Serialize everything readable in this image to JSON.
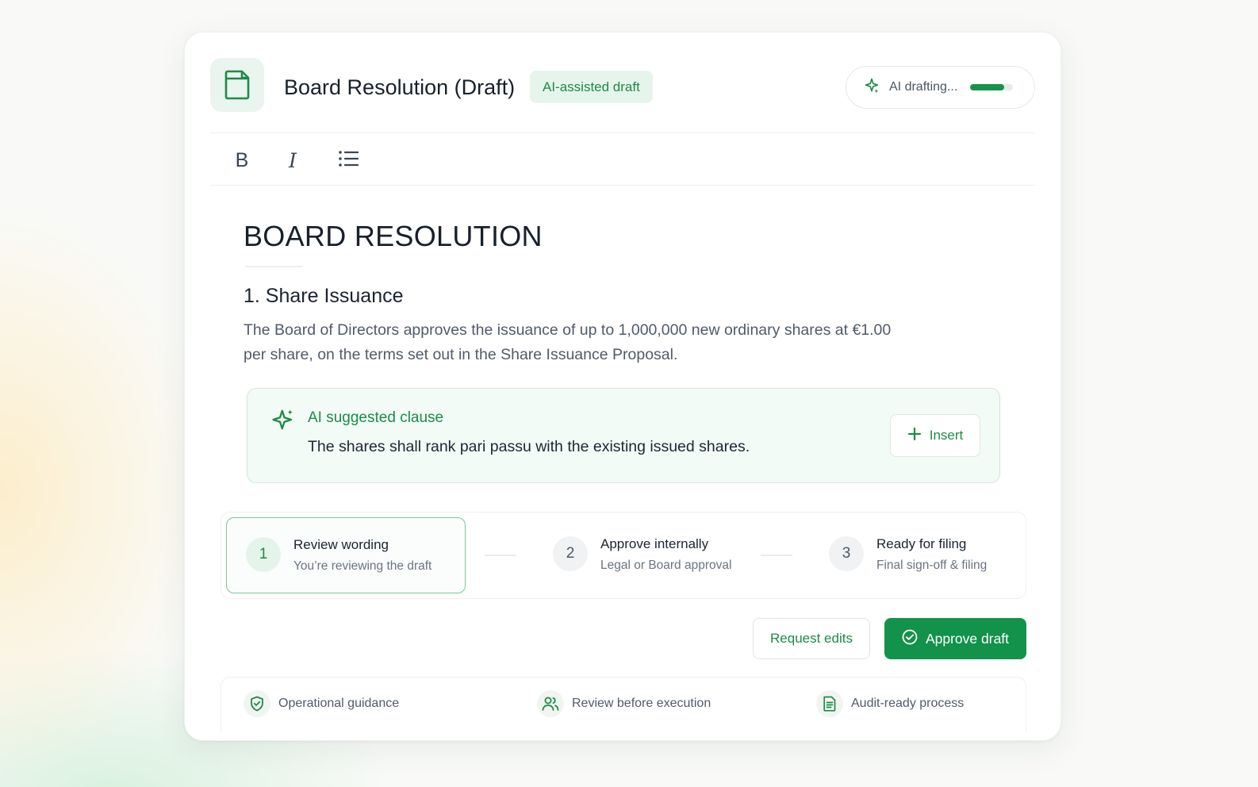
{
  "header": {
    "title": "Board Resolution (Draft)",
    "badge": "AI-assisted draft",
    "ai_status": "AI drafting...",
    "ai_progress_percent": 80,
    "doc_icon": "document-icon",
    "spark_icon": "sparkle-icon"
  },
  "toolbar": {
    "bold_label": "B",
    "italic_label": "I",
    "list_icon": "bulleted-list-icon"
  },
  "document": {
    "heading": "BOARD RESOLUTION",
    "section_title": "1. Share Issuance",
    "body": "The Board of Directors approves the issuance of up to 1,000,000 new ordinary shares at €1.00 per share, on the terms set out in the Share Issuance Proposal."
  },
  "ai_suggestion": {
    "title": "AI suggested clause",
    "text": "The shares shall rank pari passu with the existing issued shares.",
    "insert_label": "Insert"
  },
  "steps": [
    {
      "number": "1",
      "title": "Review wording",
      "subtitle": "You’re reviewing the draft",
      "active": true
    },
    {
      "number": "2",
      "title": "Approve internally",
      "subtitle": "Legal or Board approval",
      "active": false
    },
    {
      "number": "3",
      "title": "Ready for filing",
      "subtitle": "Final sign-off & filing",
      "active": false
    }
  ],
  "actions": {
    "request_label": "Request edits",
    "approve_label": "Approve draft"
  },
  "features": [
    {
      "label": "Operational guidance",
      "icon": "shield-check-icon"
    },
    {
      "label": "Review before execution",
      "icon": "users-icon"
    },
    {
      "label": "Audit-ready process",
      "icon": "document-list-icon"
    }
  ],
  "colors": {
    "accent": "#12924a",
    "accent_text": "#1f8a46",
    "accent_soft": "#e6f5eb"
  }
}
